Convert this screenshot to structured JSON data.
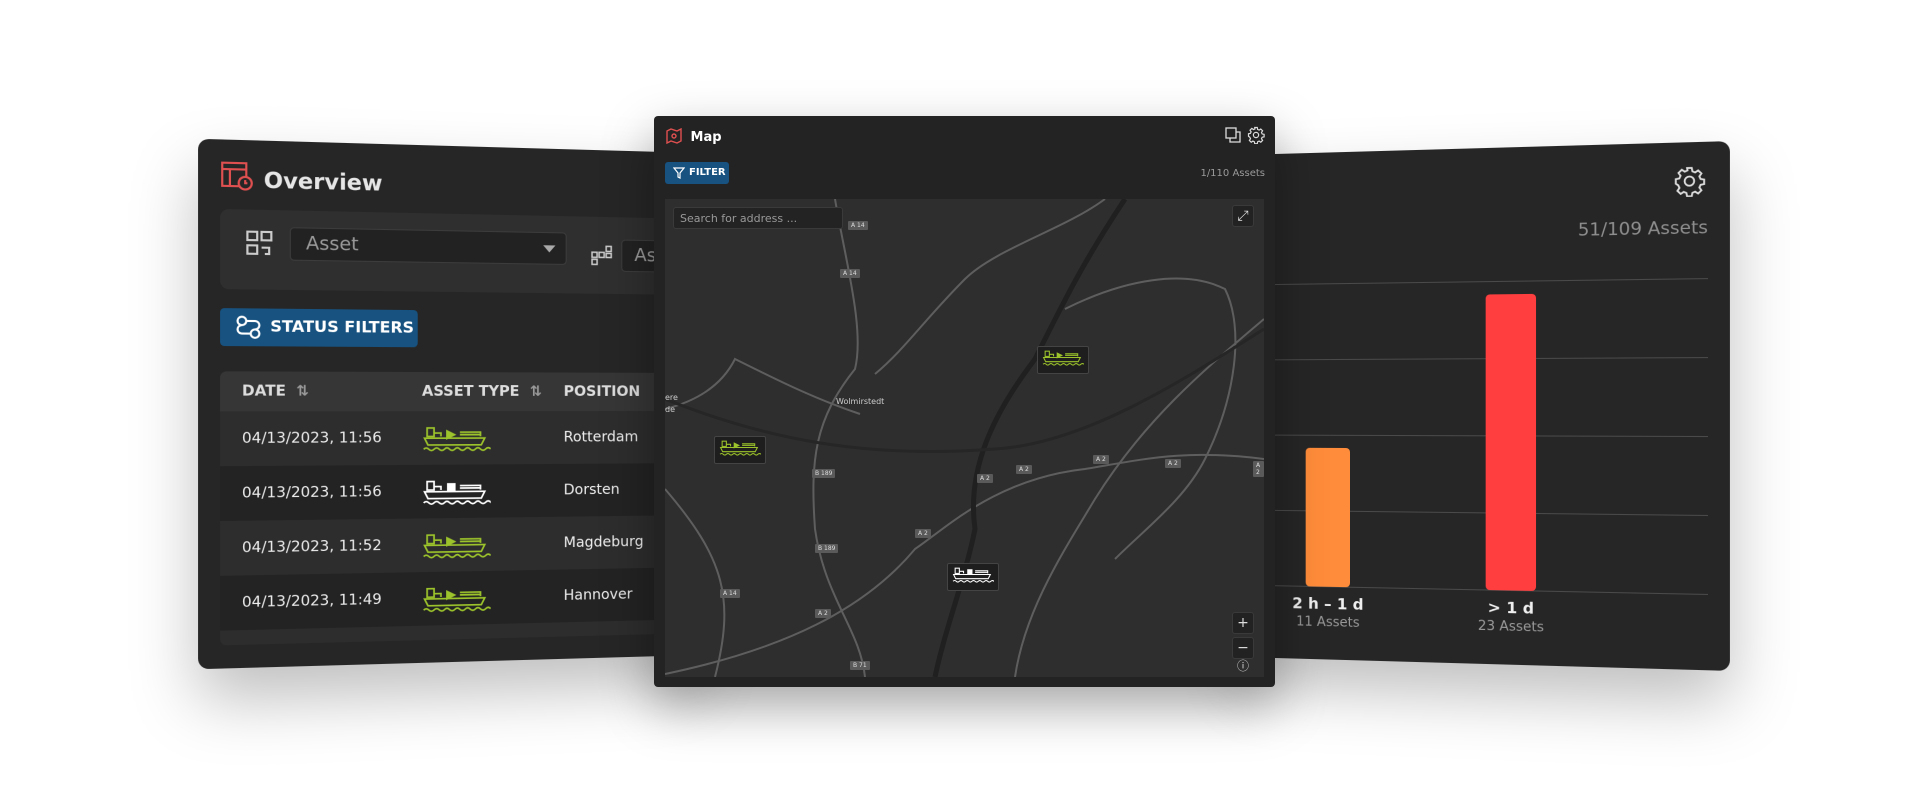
{
  "overview": {
    "title": "Overview",
    "asset_select": {
      "placeholder": "Asset"
    },
    "asset_select_2": {
      "placeholder": "Asset"
    },
    "status_filters_label": "STATUS FILTERS",
    "columns": [
      "DATE",
      "ASSET TYPE",
      "POSITION"
    ],
    "rows": [
      {
        "date": "04/13/2023, 11:56",
        "asset_type": "ship-active",
        "position": "Rotterdam"
      },
      {
        "date": "04/13/2023, 11:56",
        "asset_type": "ship-stopped",
        "position": "Dorsten"
      },
      {
        "date": "04/13/2023, 11:52",
        "asset_type": "ship-active",
        "position": "Magdeburg"
      },
      {
        "date": "04/13/2023, 11:49",
        "asset_type": "ship-active",
        "position": "Hannover"
      }
    ]
  },
  "map": {
    "title": "Map",
    "filter_label": "FILTER",
    "asset_count": "1/110 Assets",
    "search_placeholder": "Search for address ...",
    "zoom_in": "+",
    "zoom_out": "−",
    "place_labels": [
      "Wolmirstedt",
      "ere",
      "de"
    ],
    "road_labels": [
      "A 14",
      "A 14",
      "B 189",
      "B 189",
      "A 2",
      "A 2",
      "A 2",
      "A 2",
      "A 2",
      "A 2",
      "A 14",
      "A 2",
      "B 71"
    ]
  },
  "chart_panel": {
    "asset_count": "51/109 Assets"
  },
  "chart_data": {
    "type": "bar",
    "categories": [
      "2 h – 1 d",
      "> 1 d"
    ],
    "values": [
      11,
      23
    ],
    "value_labels": [
      "11 Assets",
      "23 Assets"
    ],
    "colors": [
      "#ff8c3a",
      "#ff3f3f"
    ],
    "ylim": [
      0,
      24
    ],
    "grid": true
  },
  "colors": {
    "accent_blue": "#175280",
    "active_green": "#9cc32b",
    "brand_red": "#e05050",
    "panel_bg": "#262626"
  }
}
